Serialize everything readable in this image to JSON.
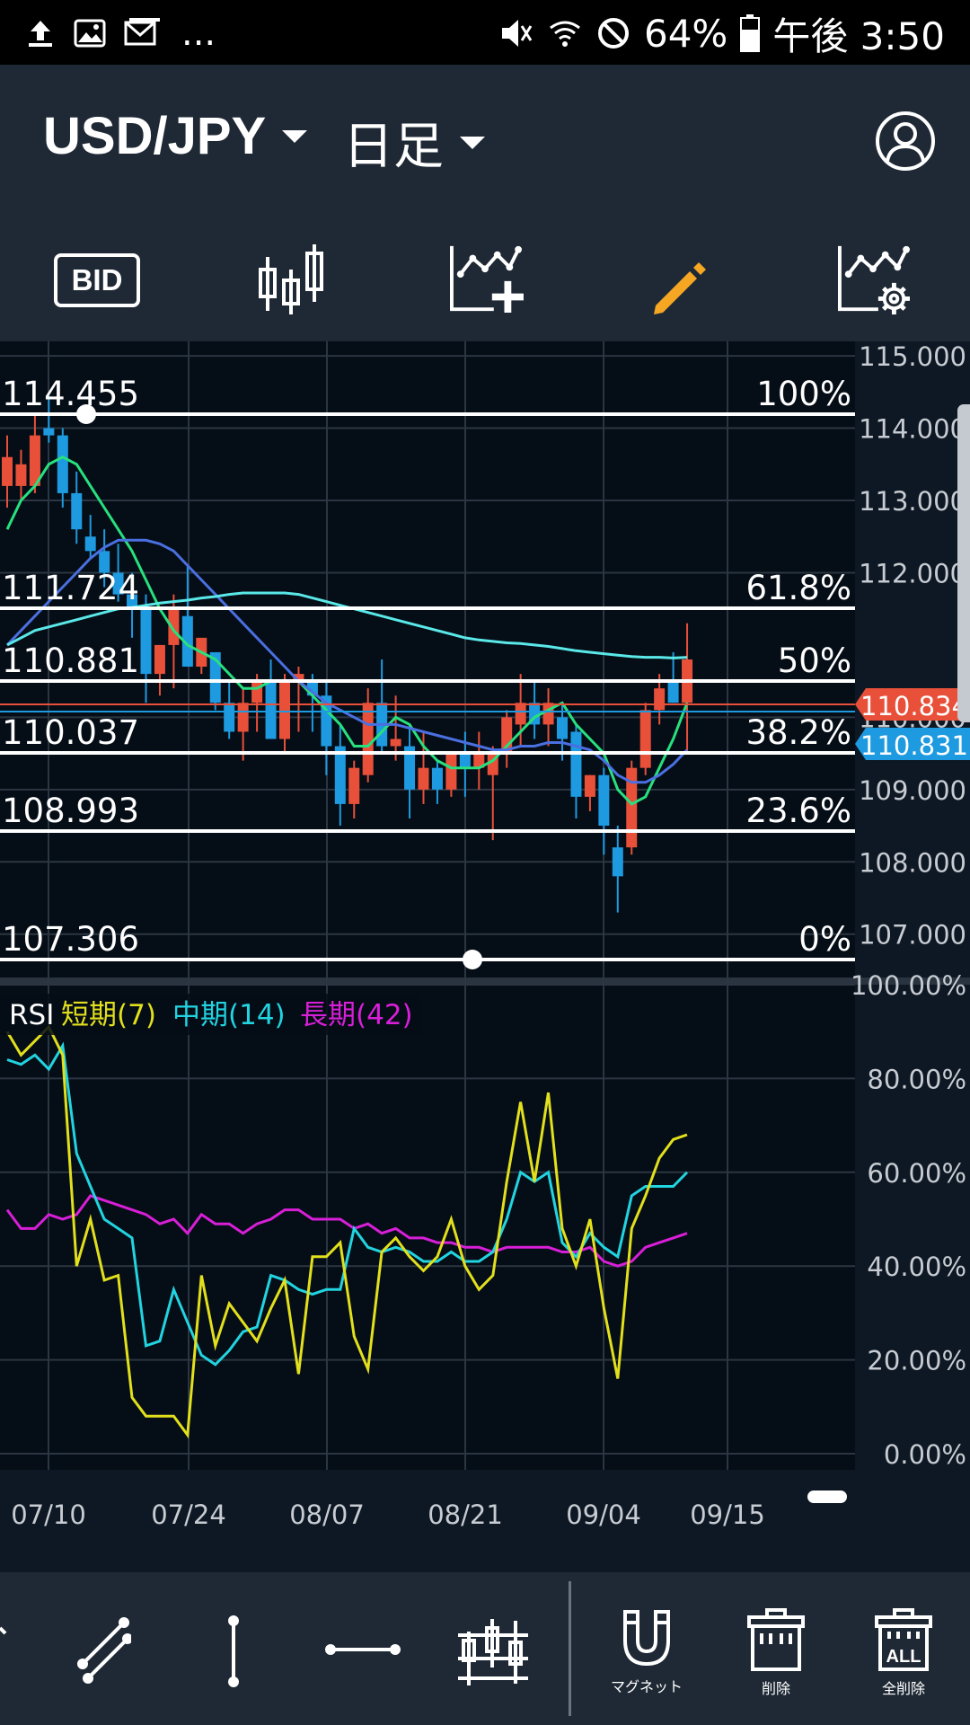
{
  "status_bar": {
    "battery": "64%",
    "time": "午後 3:50",
    "overflow": "...",
    "icons": [
      "upload-icon",
      "image-icon",
      "mail-icon",
      "mute-icon",
      "wifi-icon",
      "do-not-disturb-icon",
      "battery-icon"
    ]
  },
  "header": {
    "pair": "USD/JPY",
    "period": "日足",
    "account_icon": "user-circle-icon"
  },
  "toolbar": {
    "bid_label": "BID",
    "buttons": [
      "candlestick-icon",
      "add-indicator-icon",
      "pencil-icon",
      "indicator-settings-icon"
    ],
    "active_color": "#f5a623"
  },
  "chart_data": {
    "type": "candlestick",
    "pair": "USD/JPY",
    "timeframe": "日足",
    "x_labels": [
      "07/10",
      "07/24",
      "08/07",
      "08/21",
      "09/04",
      "09/15"
    ],
    "y_labels": [
      "115.000",
      "114.000",
      "113.000",
      "112.000",
      "110.000",
      "109.000",
      "108.000",
      "107.000"
    ],
    "ylim": [
      106.4,
      115.2
    ],
    "current_ask": "110.834",
    "current_bid": "110.831",
    "ask_color": "#e8503a",
    "bid_color": "#1e9ae0",
    "fibonacci": [
      {
        "price": "114.455",
        "level": "100%"
      },
      {
        "price": "111.724",
        "level": "61.8%"
      },
      {
        "price": "110.881",
        "level": "50%"
      },
      {
        "price": "110.037",
        "level": "38.2%"
      },
      {
        "price": "108.993",
        "level": "23.6%"
      },
      {
        "price": "107.306",
        "level": "0%"
      }
    ],
    "candles": [
      {
        "o": 113.2,
        "h": 113.9,
        "l": 112.9,
        "c": 113.6
      },
      {
        "o": 113.2,
        "h": 113.7,
        "l": 113.0,
        "c": 113.5
      },
      {
        "o": 113.2,
        "h": 114.2,
        "l": 113.1,
        "c": 113.9
      },
      {
        "o": 114.0,
        "h": 114.45,
        "l": 113.8,
        "c": 113.9
      },
      {
        "o": 113.9,
        "h": 114.0,
        "l": 112.9,
        "c": 113.1
      },
      {
        "o": 113.1,
        "h": 113.4,
        "l": 112.4,
        "c": 112.6
      },
      {
        "o": 112.5,
        "h": 112.8,
        "l": 112.2,
        "c": 112.3
      },
      {
        "o": 112.3,
        "h": 112.6,
        "l": 111.8,
        "c": 112.0
      },
      {
        "o": 112.0,
        "h": 112.4,
        "l": 111.6,
        "c": 111.7
      },
      {
        "o": 111.7,
        "h": 112.0,
        "l": 111.1,
        "c": 111.5
      },
      {
        "o": 111.5,
        "h": 111.7,
        "l": 110.2,
        "c": 110.6
      },
      {
        "o": 110.6,
        "h": 111.0,
        "l": 110.3,
        "c": 111.0
      },
      {
        "o": 111.0,
        "h": 111.7,
        "l": 110.4,
        "c": 111.5
      },
      {
        "o": 111.4,
        "h": 112.1,
        "l": 111.0,
        "c": 110.7
      },
      {
        "o": 110.7,
        "h": 111.0,
        "l": 110.6,
        "c": 111.1
      },
      {
        "o": 110.9,
        "h": 110.9,
        "l": 110.1,
        "c": 110.2
      },
      {
        "o": 110.2,
        "h": 110.5,
        "l": 109.7,
        "c": 109.8
      },
      {
        "o": 109.8,
        "h": 110.4,
        "l": 109.4,
        "c": 110.2
      },
      {
        "o": 110.2,
        "h": 110.6,
        "l": 109.8,
        "c": 110.5
      },
      {
        "o": 110.5,
        "h": 110.8,
        "l": 109.7,
        "c": 109.7
      },
      {
        "o": 109.7,
        "h": 110.6,
        "l": 109.5,
        "c": 110.5
      },
      {
        "o": 110.5,
        "h": 110.7,
        "l": 109.8,
        "c": 110.6
      },
      {
        "o": 110.5,
        "h": 110.6,
        "l": 109.8,
        "c": 110.3
      },
      {
        "o": 110.3,
        "h": 110.5,
        "l": 109.2,
        "c": 109.6
      },
      {
        "o": 109.6,
        "h": 109.9,
        "l": 108.5,
        "c": 108.8
      },
      {
        "o": 108.8,
        "h": 109.4,
        "l": 108.6,
        "c": 109.3
      },
      {
        "o": 109.2,
        "h": 110.4,
        "l": 109.1,
        "c": 110.2
      },
      {
        "o": 110.2,
        "h": 110.8,
        "l": 109.5,
        "c": 109.6
      },
      {
        "o": 109.6,
        "h": 110.3,
        "l": 109.4,
        "c": 109.7
      },
      {
        "o": 109.6,
        "h": 109.9,
        "l": 108.6,
        "c": 109.0
      },
      {
        "o": 109.0,
        "h": 109.8,
        "l": 108.8,
        "c": 109.3
      },
      {
        "o": 109.3,
        "h": 109.4,
        "l": 108.8,
        "c": 109.0
      },
      {
        "o": 109.0,
        "h": 109.5,
        "l": 108.9,
        "c": 109.5
      },
      {
        "o": 109.5,
        "h": 109.8,
        "l": 108.9,
        "c": 109.3
      },
      {
        "o": 109.3,
        "h": 109.8,
        "l": 109.0,
        "c": 109.5
      },
      {
        "o": 109.2,
        "h": 109.6,
        "l": 108.3,
        "c": 109.5
      },
      {
        "o": 109.5,
        "h": 110.1,
        "l": 109.3,
        "c": 110.0
      },
      {
        "o": 109.9,
        "h": 110.6,
        "l": 109.6,
        "c": 110.2
      },
      {
        "o": 110.2,
        "h": 110.5,
        "l": 109.7,
        "c": 109.9
      },
      {
        "o": 109.9,
        "h": 110.4,
        "l": 109.6,
        "c": 110.2
      },
      {
        "o": 110.0,
        "h": 110.2,
        "l": 109.4,
        "c": 109.7
      },
      {
        "o": 109.8,
        "h": 109.9,
        "l": 108.6,
        "c": 108.9
      },
      {
        "o": 108.9,
        "h": 109.2,
        "l": 108.7,
        "c": 109.2
      },
      {
        "o": 109.2,
        "h": 109.3,
        "l": 108.1,
        "c": 108.5
      },
      {
        "o": 108.2,
        "h": 108.5,
        "l": 107.3,
        "c": 107.8
      },
      {
        "o": 108.2,
        "h": 109.4,
        "l": 108.1,
        "c": 109.3
      },
      {
        "o": 109.3,
        "h": 110.2,
        "l": 109.2,
        "c": 110.1
      },
      {
        "o": 110.1,
        "h": 110.6,
        "l": 109.9,
        "c": 110.4
      },
      {
        "o": 110.5,
        "h": 110.9,
        "l": 110.2,
        "c": 110.2
      },
      {
        "o": 110.2,
        "h": 111.3,
        "l": 109.5,
        "c": 110.8
      }
    ],
    "moving_averages": [
      {
        "color": "#27e07e",
        "values": [
          112.6,
          113.0,
          113.2,
          113.5,
          113.6,
          113.5,
          113.2,
          112.9,
          112.6,
          112.3,
          111.9,
          111.5,
          111.2,
          111.0,
          110.9,
          110.8,
          110.6,
          110.4,
          110.4,
          110.5,
          110.5,
          110.5,
          110.3,
          110.1,
          109.9,
          109.6,
          109.6,
          109.8,
          110.0,
          109.9,
          109.6,
          109.4,
          109.3,
          109.3,
          109.3,
          109.4,
          109.6,
          109.8,
          110.0,
          110.1,
          110.2,
          109.9,
          109.7,
          109.5,
          109.0,
          108.8,
          108.9,
          109.3,
          109.7,
          110.2
        ]
      },
      {
        "color": "#4a6fe0",
        "values": [
          111.0,
          111.2,
          111.4,
          111.6,
          111.8,
          112.0,
          112.2,
          112.35,
          112.45,
          112.45,
          112.45,
          112.4,
          112.3,
          112.1,
          111.9,
          111.7,
          111.5,
          111.3,
          111.1,
          110.9,
          110.7,
          110.5,
          110.35,
          110.2,
          110.1,
          110.0,
          109.9,
          109.9,
          109.9,
          109.85,
          109.8,
          109.75,
          109.7,
          109.65,
          109.6,
          109.55,
          109.55,
          109.6,
          109.6,
          109.65,
          109.65,
          109.6,
          109.55,
          109.4,
          109.2,
          109.1,
          109.1,
          109.2,
          109.35,
          109.55
        ]
      },
      {
        "color": "#5ae8e8",
        "values": [
          111.0,
          111.1,
          111.2,
          111.25,
          111.3,
          111.35,
          111.4,
          111.45,
          111.5,
          111.52,
          111.55,
          111.58,
          111.6,
          111.62,
          111.65,
          111.67,
          111.7,
          111.72,
          111.72,
          111.72,
          111.72,
          111.7,
          111.65,
          111.6,
          111.55,
          111.5,
          111.45,
          111.4,
          111.35,
          111.3,
          111.25,
          111.2,
          111.15,
          111.1,
          111.07,
          111.05,
          111.03,
          111.02,
          111.0,
          110.98,
          110.95,
          110.92,
          110.9,
          110.88,
          110.86,
          110.84,
          110.83,
          110.83,
          110.82,
          110.83
        ]
      }
    ]
  },
  "rsi": {
    "title": "RSI",
    "short_label": "短期(7)",
    "mid_label": "中期(14)",
    "long_label": "長期(42)",
    "y_labels": [
      "100.00%",
      "80.00%",
      "60.00%",
      "40.00%",
      "20.00%",
      "0.00%"
    ],
    "short_color": "#e2df1c",
    "mid_color": "#22d3e0",
    "long_color": "#d81fd8",
    "short": [
      90,
      85,
      88,
      91,
      85,
      40,
      50,
      37,
      38,
      12,
      8,
      8,
      8,
      4,
      38,
      23,
      32,
      28,
      24,
      31,
      37,
      17,
      42,
      42,
      45,
      25,
      18,
      43,
      46,
      42,
      39,
      42,
      50,
      40,
      35,
      38,
      58,
      75,
      58,
      77,
      48,
      40,
      50,
      31,
      16,
      48,
      55,
      63,
      67,
      68
    ],
    "mid": [
      84,
      83,
      85,
      82,
      87,
      64,
      57,
      50,
      48,
      46,
      23,
      24,
      35,
      28,
      21,
      19,
      22,
      26,
      27,
      38,
      37,
      35,
      34,
      35,
      35,
      48,
      44,
      43,
      44,
      43,
      41,
      41,
      43,
      41,
      41,
      43,
      50,
      60,
      58,
      60,
      45,
      42,
      47,
      44,
      42,
      55,
      57,
      57,
      57,
      60
    ],
    "long": [
      52,
      48,
      48,
      51,
      50,
      51,
      55,
      54,
      53,
      52,
      51,
      49,
      50,
      47,
      51,
      49,
      49,
      47,
      49,
      50,
      52,
      52,
      50,
      50,
      50,
      48,
      49,
      47,
      48,
      46,
      46,
      45,
      45,
      44,
      44,
      43,
      44,
      44,
      44,
      44,
      43,
      43,
      44,
      41,
      40,
      41,
      44,
      45,
      46,
      47
    ]
  },
  "bottom_tools": {
    "tools": [
      "cursor-icon",
      "trendline-icon",
      "vertical-line-icon",
      "horizontal-line-icon",
      "fibonacci-icon"
    ],
    "magnet_label": "マグネット",
    "delete_label": "削除",
    "delete_all_label": "全削除",
    "all_badge": "ALL"
  }
}
